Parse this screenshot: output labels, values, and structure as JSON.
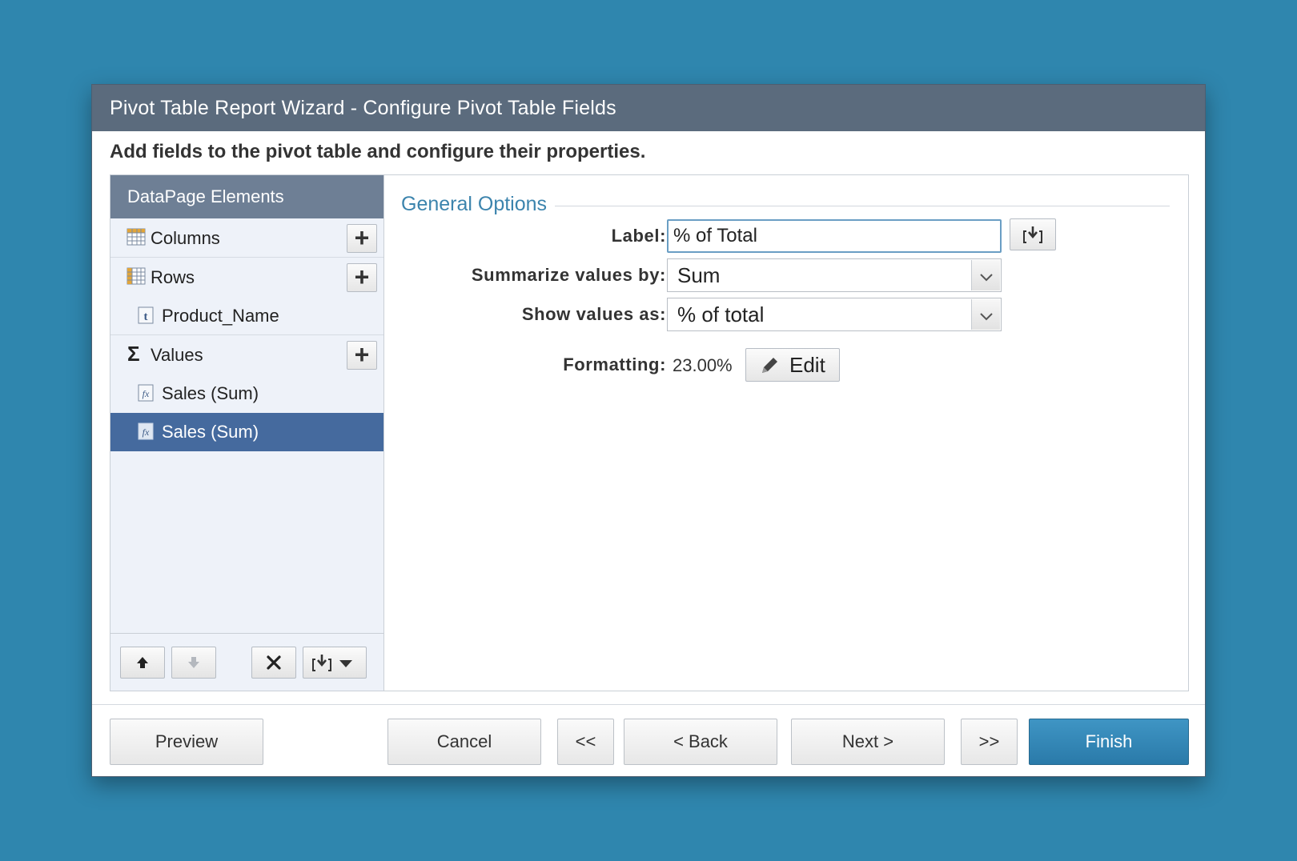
{
  "dialog": {
    "title": "Pivot Table Report Wizard - Configure Pivot Table Fields",
    "subtitle": "Add fields to the pivot table and configure their properties."
  },
  "sidebar": {
    "header": "DataPage Elements",
    "groups": [
      {
        "label": "Columns",
        "icon": "table-grid-icon",
        "children": []
      },
      {
        "label": "Rows",
        "icon": "table-grid-icon",
        "children": [
          {
            "label": "Product_Name",
            "icon": "text-field-icon"
          }
        ]
      },
      {
        "label": "Values",
        "icon": "sigma-icon",
        "children": [
          {
            "label": "Sales (Sum)",
            "icon": "formula-icon"
          },
          {
            "label": "Sales (Sum)",
            "icon": "formula-icon",
            "selected": true
          }
        ]
      }
    ],
    "toolbar": {
      "move_up": "up-arrow-icon",
      "move_down": "down-arrow-icon",
      "delete": "delete-x-icon",
      "insert": "insert-dropdown-icon"
    }
  },
  "general_options": {
    "legend": "General Options",
    "label_label": "Label:",
    "label_value": "% of Total",
    "summarize_label": "Summarize values by:",
    "summarize_value": "Sum",
    "show_as_label": "Show values as:",
    "show_as_value": "% of total",
    "formatting_label": "Formatting:",
    "formatting_value": "23.00%",
    "edit_label": "Edit"
  },
  "footer": {
    "preview": "Preview",
    "cancel": "Cancel",
    "first": "<<",
    "back": "< Back",
    "next": "Next >",
    "last": ">>",
    "finish": "Finish"
  },
  "colors": {
    "background": "#2f86ae",
    "titlebar": "#5b6b7d",
    "sidebar_header": "#6e7f95",
    "selected_row": "#456a9e",
    "accent": "#3c84ad",
    "finish_button": "#2f88b8"
  }
}
